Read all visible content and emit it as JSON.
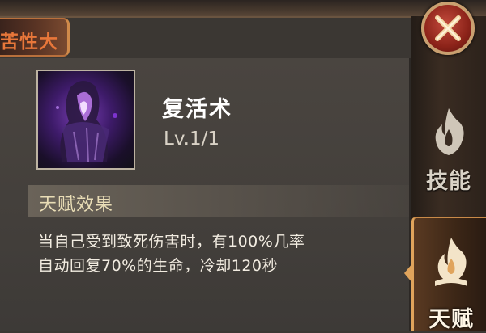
{
  "window": {
    "title_partial": "苦性大"
  },
  "skill": {
    "name": "复活术",
    "level": "Lv.1/1",
    "icon": "revive-skill-icon"
  },
  "effect": {
    "label": "天赋效果",
    "lines": [
      "当自己受到致死伤害时，有100%几率",
      "自动回复70%的生命，冷却120秒"
    ]
  },
  "side_tabs": [
    {
      "label": "技能",
      "icon": "skill-flame-icon",
      "active": false
    },
    {
      "label": "天赋",
      "icon": "talent-flame-icon",
      "active": true
    }
  ],
  "close_icon": "close-icon",
  "colors": {
    "accent_orange": "#e8773a",
    "close_red": "#a52a1e",
    "effect_text": "#e9ddb6",
    "tab_gold": "#e0a45c"
  }
}
